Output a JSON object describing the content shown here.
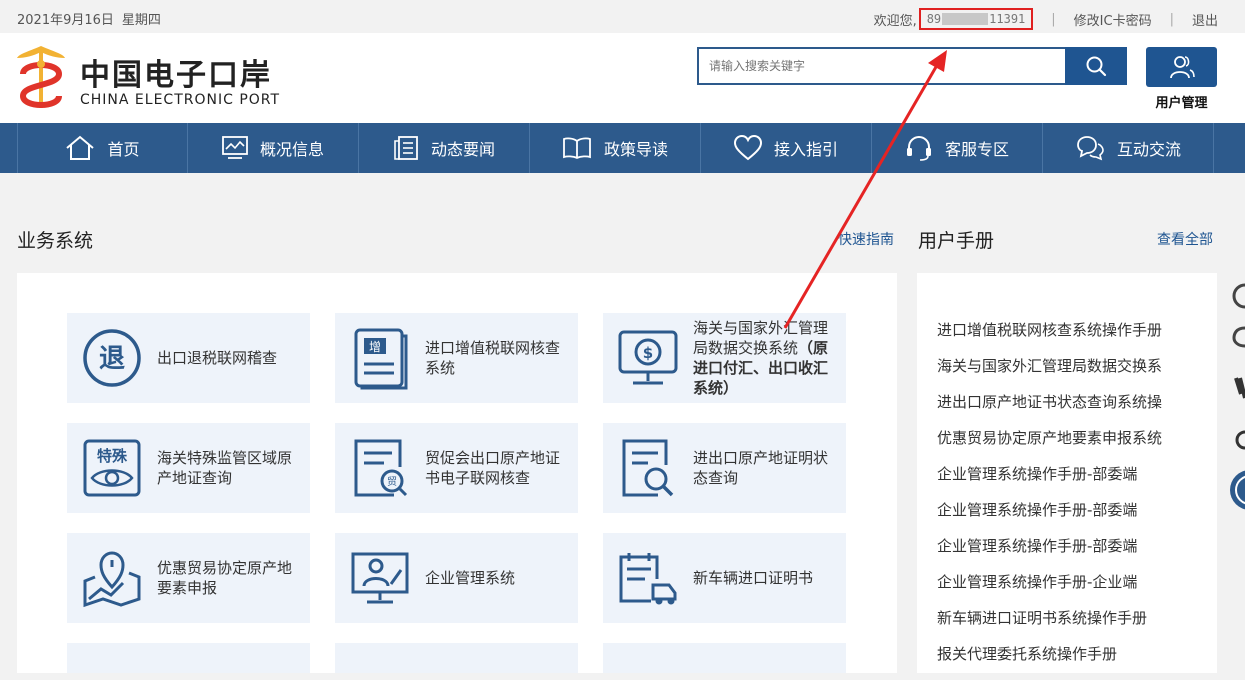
{
  "topbar": {
    "date": "2021年9月16日",
    "weekday": "星期四",
    "welcome": "欢迎您,",
    "user_prefix": "89",
    "user_suffix": "11391",
    "change_password": "修改IC卡密码",
    "logout": "退出",
    "separator": "|"
  },
  "logo": {
    "cn": "中国电子口岸",
    "en": "CHINA ELECTRONIC PORT"
  },
  "search": {
    "placeholder": "请输入搜索关键字"
  },
  "user_management": {
    "label": "用户管理"
  },
  "nav": [
    {
      "label": "首页",
      "icon": "home-icon"
    },
    {
      "label": "概况信息",
      "icon": "chart-icon"
    },
    {
      "label": "动态要闻",
      "icon": "news-icon"
    },
    {
      "label": "政策导读",
      "icon": "book-icon"
    },
    {
      "label": "接入指引",
      "icon": "heart-icon"
    },
    {
      "label": "客服专区",
      "icon": "headset-icon"
    },
    {
      "label": "互动交流",
      "icon": "chat-icon"
    }
  ],
  "business": {
    "title": "业务系统",
    "link": "快速指南",
    "cards": [
      {
        "label": "出口退税联网稽查",
        "icon": "tax-refund-icon",
        "icon_text": "退"
      },
      {
        "label": "进口增值税联网核查系统",
        "icon": "vat-document-icon",
        "icon_text": "增"
      },
      {
        "label": "海关与国家外汇管理局数据交换系统",
        "label_bold": "（原进口付汇、出口收汇系统）",
        "icon": "forex-monitor-icon"
      },
      {
        "label": "海关特殊监管区域原产地证查询",
        "icon": "special-zone-icon",
        "icon_text": "特殊"
      },
      {
        "label": "贸促会出口原产地证书电子联网核查",
        "icon": "ccpit-certificate-icon",
        "icon_text": "贸"
      },
      {
        "label": "进出口原产地证明状态查询",
        "icon": "origin-search-icon"
      },
      {
        "label": "优惠贸易协定原产地要素申报",
        "icon": "map-pin-icon"
      },
      {
        "label": "企业管理系统",
        "icon": "enterprise-icon"
      },
      {
        "label": "新车辆进口证明书",
        "icon": "vehicle-icon"
      }
    ]
  },
  "manual": {
    "title": "用户手册",
    "link": "查看全部",
    "items": [
      "进口增值税联网核查系统操作手册",
      "海关与国家外汇管理局数据交换系",
      "进出口原产地证书状态查询系统操",
      "优惠贸易协定原产地要素申报系统",
      "企业管理系统操作手册-部委端",
      "企业管理系统操作手册-部委端",
      "企业管理系统操作手册-部委端",
      "企业管理系统操作手册-企业端",
      "新车辆进口证明书系统操作手册",
      "报关代理委托系统操作手册"
    ]
  },
  "colors": {
    "brand": "#2d5a8c",
    "button": "#1f5591",
    "card_bg": "#eef3fa",
    "highlight": "#e02020"
  }
}
